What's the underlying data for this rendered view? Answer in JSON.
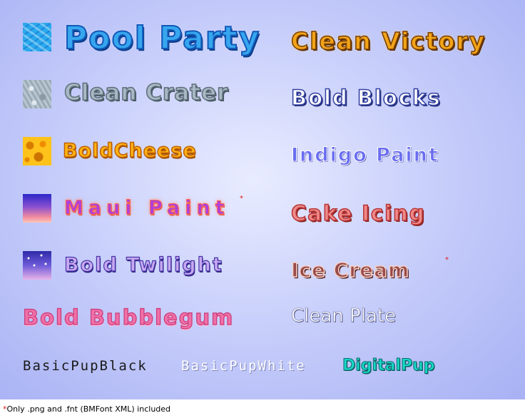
{
  "fonts": {
    "pool_party": "Pool Party",
    "clean_victory": "Clean Victory",
    "clean_crater": "Clean Crater",
    "bold_blocks": "Bold Blocks",
    "bold_cheese": "BoldCheese",
    "indigo_paint": "Indigo Paint",
    "maui_paint": "Maui Paint",
    "cake_icing": "Cake Icing",
    "bold_twilight": "Bold Twilight",
    "ice_cream": "Ice Cream",
    "bold_bubblegum": "Bold Bubblegum",
    "clean_plate": "Clean Plate",
    "basic_pup_black": "BasicPupBlack",
    "basic_pup_white": "BasicPupWhite",
    "digital_pup": "DigitalPup"
  },
  "asterisk": "*",
  "footnote": {
    "marker": "*",
    "text": "Only .png and .fnt (BMFont XML) included"
  },
  "colors": {
    "background_center": "#e9ecff",
    "background_edge": "#a8b1f4",
    "asterisk": "#e01818"
  }
}
